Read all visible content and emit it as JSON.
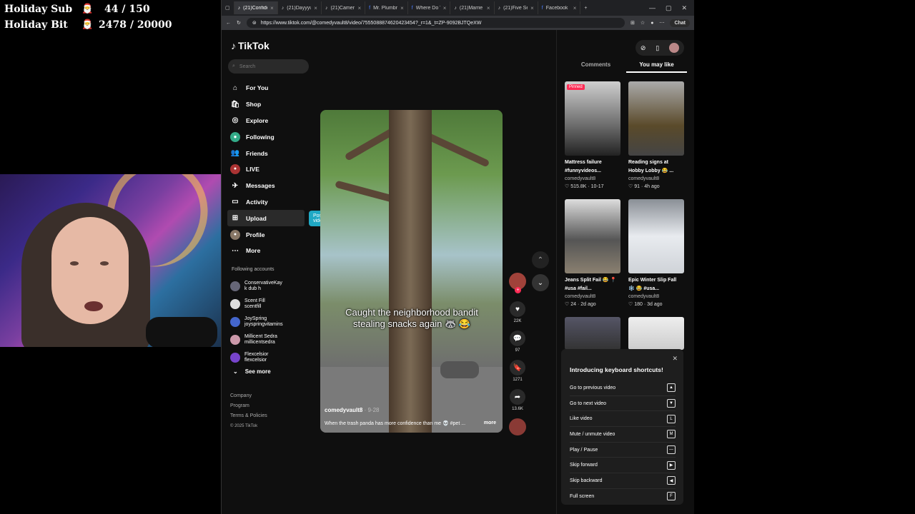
{
  "overlay": {
    "holiday_sub": {
      "label": "Holiday Sub",
      "value": "44 / 150"
    },
    "holiday_bit": {
      "label": "Holiday Bit",
      "value": "2478 / 20000"
    }
  },
  "browser": {
    "tabs": [
      {
        "label": "(21)Confide",
        "active": true
      },
      {
        "label": "(21)Dayyyu"
      },
      {
        "label": "(21)Camera"
      },
      {
        "label": "Mr. Plumbr"
      },
      {
        "label": "Where Do Y"
      },
      {
        "label": "(21)Marrie"
      },
      {
        "label": "(21)Five Se"
      },
      {
        "label": "Facebook"
      }
    ],
    "url": "https://www.tiktok.com/@comedyvault8/video/7555088874620423454?_r=1&_t=ZP-9092BJTQeXW",
    "chat_label": "Chat"
  },
  "tiktok": {
    "logo": "TikTok",
    "search_placeholder": "Search",
    "nav": [
      {
        "label": "For You",
        "icon": "home-icon"
      },
      {
        "label": "Shop",
        "icon": "shop-icon"
      },
      {
        "label": "Explore",
        "icon": "compass-icon"
      },
      {
        "label": "Following",
        "icon": "following-icon"
      },
      {
        "label": "Friends",
        "icon": "friends-icon"
      },
      {
        "label": "LIVE",
        "icon": "live-icon"
      },
      {
        "label": "Messages",
        "icon": "messages-icon"
      },
      {
        "label": "Activity",
        "icon": "activity-icon"
      },
      {
        "label": "Upload",
        "icon": "upload-icon"
      },
      {
        "label": "Profile",
        "icon": "profile-icon"
      },
      {
        "label": "More",
        "icon": "more-icon"
      }
    ],
    "post_video_label": "Post video",
    "following_title": "Following accounts",
    "following": [
      {
        "name": "ConservativeKay",
        "handle": "k dub h"
      },
      {
        "name": "Scent Fill",
        "handle": "scentfill"
      },
      {
        "name": "JoySpring",
        "handle": "joyspringvitamins"
      },
      {
        "name": "Millicent Sedra",
        "handle": "millicentsedra"
      },
      {
        "name": "Flexcelsior",
        "handle": "flexcelsior"
      }
    ],
    "see_more": "See more",
    "footer": [
      "Company",
      "Program",
      "Terms & Policies",
      "© 2025 TikTok"
    ],
    "video": {
      "caption_line1": "Caught the neighborhood bandit",
      "caption_line2": "stealing snacks again 🦝 😂",
      "author": "comedyvault8",
      "date": "· 9-28",
      "description": "When the trash panda has more confidence than me 💀 #pet ...",
      "more": "more"
    },
    "actions": {
      "likes": "22K",
      "comments": "97",
      "saves": "1271",
      "shares": "13.6K"
    },
    "right_tabs": {
      "comments": "Comments",
      "you_may_like": "You may like"
    },
    "cards": [
      {
        "title": "Mattress failure #funnyvideos...",
        "author": "comedyvault8",
        "likes": "515.8K",
        "date": "10-17",
        "pinned": "Pinned"
      },
      {
        "title": "Reading signs at Hobby Lobby 😂 ...",
        "author": "comedyvault8",
        "likes": "91",
        "date": "4h ago"
      },
      {
        "title": "Jeans Split Fail 😂 📍 #usa #fail...",
        "author": "comedyvault8",
        "likes": "24",
        "date": "2d ago"
      },
      {
        "title": "Epic Winter Slip Fall ❄️ 😂 #usa...",
        "author": "comedyvault8",
        "likes": "180",
        "date": "3d ago"
      }
    ],
    "shortcuts": {
      "title": "Introducing keyboard shortcuts!",
      "items": [
        {
          "label": "Go to previous video",
          "key": "▲"
        },
        {
          "label": "Go to next video",
          "key": "▼"
        },
        {
          "label": "Like video",
          "key": "L"
        },
        {
          "label": "Mute / unmute video",
          "key": "M"
        },
        {
          "label": "Play / Pause",
          "key": "—"
        },
        {
          "label": "Skip forward",
          "key": "▶"
        },
        {
          "label": "Skip backward",
          "key": "◀"
        },
        {
          "label": "Full screen",
          "key": "F"
        }
      ]
    }
  }
}
